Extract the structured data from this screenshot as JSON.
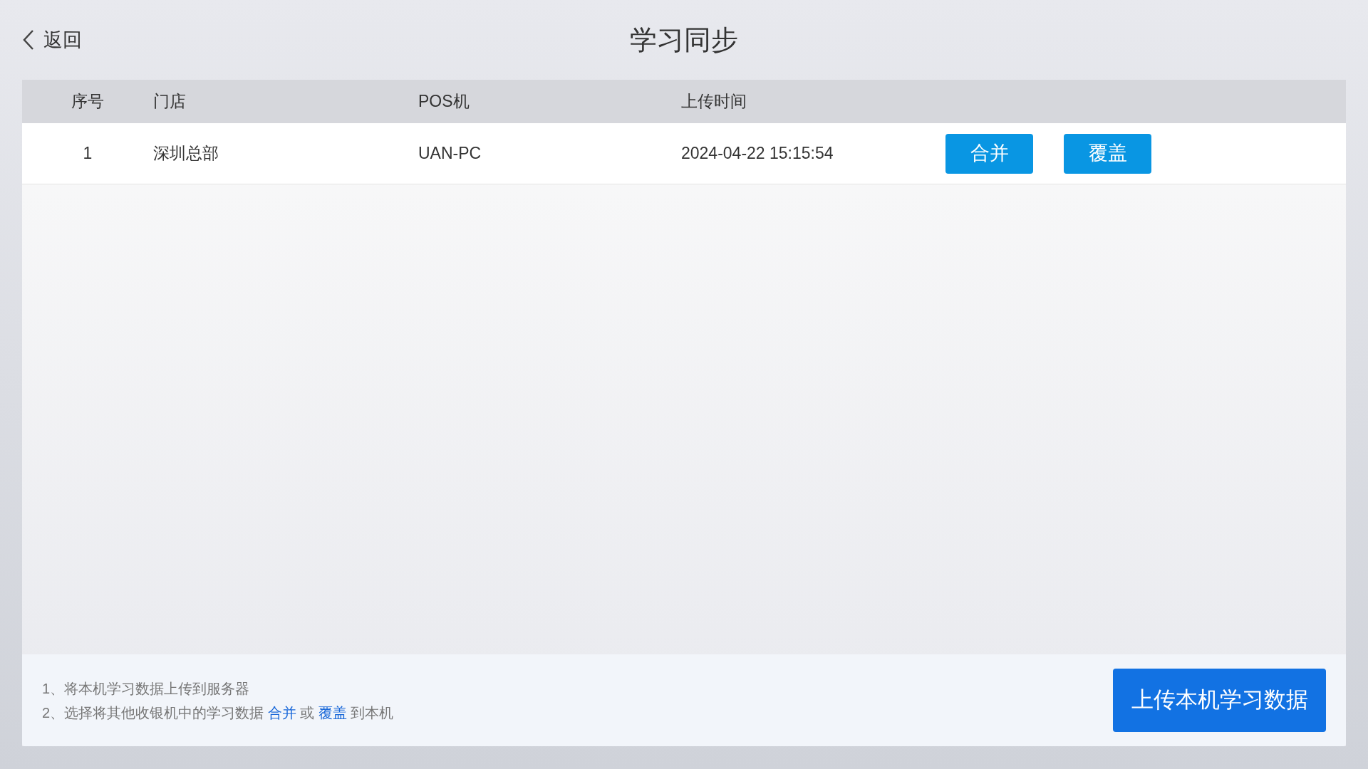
{
  "header": {
    "back_label": "返回",
    "title": "学习同步"
  },
  "table": {
    "columns": [
      "序号",
      "门店",
      "POS机",
      "上传时间"
    ],
    "rows": [
      {
        "index": "1",
        "store": "深圳总部",
        "pos": "UAN-PC",
        "upload_time": "2024-04-22 15:15:54",
        "actions": [
          "合并",
          "覆盖"
        ]
      }
    ]
  },
  "footer": {
    "notes": [
      [
        {
          "kind": "text",
          "text": "1、将本机学习数据上传到服务器"
        }
      ],
      [
        {
          "kind": "text",
          "text": "2、选择将其他收银机中的学习数据 "
        },
        {
          "kind": "link",
          "text": "合并"
        },
        {
          "kind": "text",
          "text": " 或 "
        },
        {
          "kind": "link",
          "text": "覆盖"
        },
        {
          "kind": "text",
          "text": " 到本机"
        }
      ]
    ],
    "upload_button": "上传本机学习数据"
  }
}
